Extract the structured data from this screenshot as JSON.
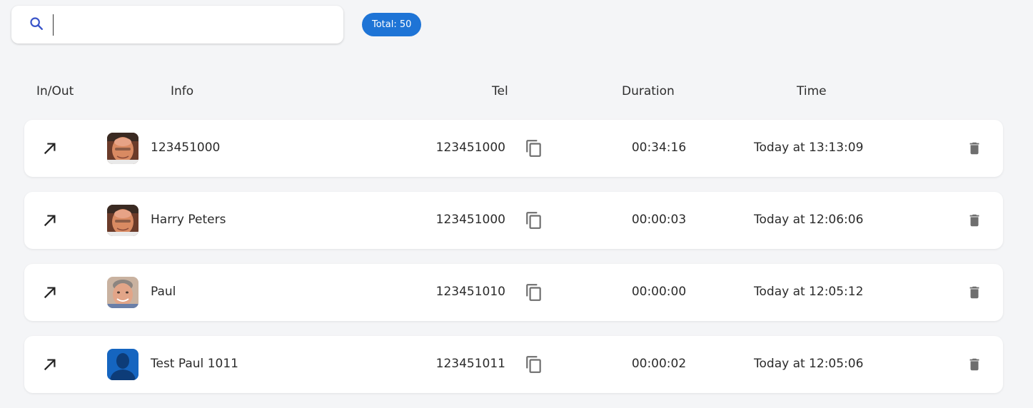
{
  "search": {
    "value": "",
    "placeholder": ""
  },
  "total_badge": "Total: 50",
  "columns": {
    "in_out": "In/Out",
    "info": "Info",
    "tel": "Tel",
    "duration": "Duration",
    "time": "Time"
  },
  "icons": {
    "search": "search-icon",
    "direction": "outgoing-arrow-icon",
    "copy": "copy-icon",
    "delete": "trash-icon"
  },
  "colors": {
    "accent": "#1e74d6",
    "search_icon": "#3a55c9",
    "icon_gray": "#6e6e6e"
  },
  "calls": [
    {
      "direction": "outgoing",
      "avatar": "photo-bald-man-1",
      "name": "123451000",
      "tel": "123451000",
      "duration": "00:34:16",
      "time": "Today at 13:13:09"
    },
    {
      "direction": "outgoing",
      "avatar": "photo-bald-man-1",
      "name": "Harry Peters",
      "tel": "123451000",
      "duration": "00:00:03",
      "time": "Today at 12:06:06"
    },
    {
      "direction": "outgoing",
      "avatar": "photo-man-2",
      "name": "Paul",
      "tel": "123451010",
      "duration": "00:00:00",
      "time": "Today at 12:05:12"
    },
    {
      "direction": "outgoing",
      "avatar": "default-silhouette",
      "name": "Test Paul 1011",
      "tel": "123451011",
      "duration": "00:00:02",
      "time": "Today at 12:05:06"
    }
  ]
}
